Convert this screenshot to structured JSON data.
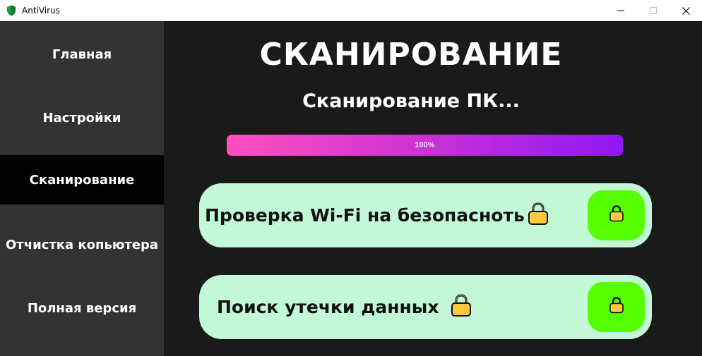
{
  "window": {
    "title": "AntiVirus",
    "icon": "shield-icon",
    "controls": [
      "minimize-icon",
      "maximize-icon",
      "close-icon"
    ]
  },
  "sidebar": {
    "items": [
      {
        "label": "Главная",
        "active": false
      },
      {
        "label": "Настройки",
        "active": false
      },
      {
        "label": "Сканирование",
        "active": true
      },
      {
        "label": "Отчистка копьютера",
        "active": false
      },
      {
        "label": "Полная версия",
        "active": false
      }
    ]
  },
  "main": {
    "heading": "СКАНИРОВАНИЕ",
    "status": "Сканирование ПК...",
    "progress": {
      "value": 100,
      "label": "100%"
    },
    "cards": [
      {
        "label": "Проверка Wi-Fi на безопасноть",
        "icon": "lock-icon",
        "button_icon": "lock-icon"
      },
      {
        "label": "Поиск утечки данных",
        "icon": "lock-icon",
        "button_icon": "lock-icon"
      }
    ]
  },
  "colors": {
    "sidebar_bg": "#333333",
    "sidebar_active_bg": "#000000",
    "main_bg": "#1a1a1a",
    "card_bg": "#c2f8d6",
    "card_button_bg": "#55ff00",
    "progress_gradient_start": "#ff4fbf",
    "progress_gradient_end": "#8f17f5"
  }
}
